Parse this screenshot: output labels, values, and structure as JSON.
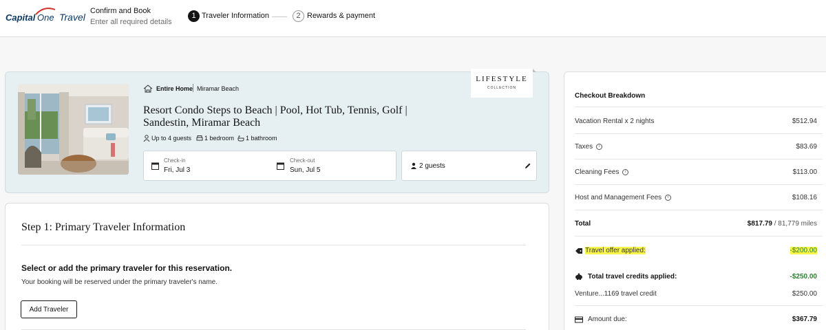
{
  "header": {
    "logo_capital": "Capital",
    "logo_one": "One",
    "logo_travel": "Travel",
    "title": "Confirm and Book",
    "subtitle": "Enter all required details",
    "steps": [
      {
        "number": "1",
        "label": "Traveler Information",
        "active": true
      },
      {
        "number": "2",
        "label": "Rewards & payment",
        "active": false
      }
    ]
  },
  "property": {
    "type": "Entire Home",
    "location": "Miramar Beach",
    "title": "Resort Condo Steps to Beach | Pool, Hot Tub, Tennis, Golf | Sandestin, Miramar Beach",
    "amenities": [
      "Up to 4 guests",
      "1 bedroom",
      "1 bathroom"
    ],
    "checkin_label": "Check-in",
    "checkin_value": "Fri, Jul 3",
    "checkout_label": "Check-out",
    "checkout_value": "Sun, Jul 5",
    "guests": "2 guests",
    "badge_title": "LIFESTYLE",
    "badge_sub": "COLLECTION"
  },
  "traveler": {
    "heading": "Step 1: Primary Traveler Information",
    "question": "Select or add the primary traveler for this reservation.",
    "note": "Your booking will be reserved under the primary traveler's name.",
    "add_button": "Add Traveler"
  },
  "checkout": {
    "title": "Checkout Breakdown",
    "rows": [
      {
        "label": "Vacation Rental x 2 nights",
        "amount": "$512.94"
      },
      {
        "label": "Taxes",
        "amount": "$83.69"
      },
      {
        "label": "Cleaning Fees",
        "amount": "$113.00"
      },
      {
        "label": "Host and Management Fees",
        "amount": "$108.16"
      }
    ],
    "total_label": "Total",
    "total_amount": "$817.79",
    "total_miles": "/ 81,779 miles",
    "offer_label": "Travel offer applied:",
    "offer_amount": "-$200.00",
    "credits_label": "Total travel credits applied:",
    "credits_amount": "-$250.00",
    "credit_source_label": "Venture...1169 travel credit",
    "credit_source_amount": "$250.00",
    "amount_due_label": "Amount due:",
    "amount_due": "$367.79"
  },
  "colors": {
    "brand_navy": "#0b3a65",
    "brand_red": "#d03027",
    "card_bg": "#e6f0f3",
    "highlight": "#f7f54a",
    "credit_green": "#2e7d32"
  }
}
